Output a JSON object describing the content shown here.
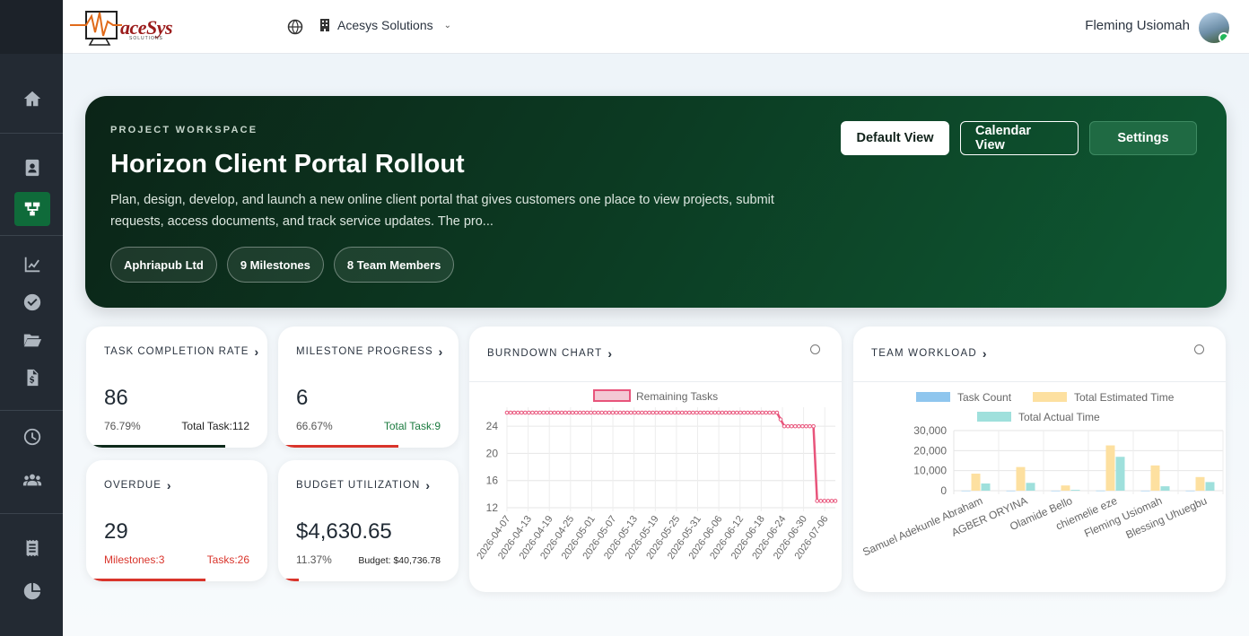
{
  "header": {
    "brand_text": "aceSys",
    "brand_sub": "SOLUTIONS",
    "org_name": "Acesys Solutions",
    "user_name": "Fleming Usiomah"
  },
  "sidebar": {
    "items": [
      {
        "icon": "home-icon"
      },
      {
        "icon": "contacts-icon"
      },
      {
        "icon": "project-tree-icon",
        "active": true
      },
      {
        "icon": "chart-line-icon"
      },
      {
        "icon": "check-circle-icon"
      },
      {
        "icon": "folder-open-icon"
      },
      {
        "icon": "invoice-icon"
      },
      {
        "icon": "clock-icon"
      },
      {
        "icon": "users-icon"
      },
      {
        "icon": "receipt-icon"
      },
      {
        "icon": "pie-chart-icon"
      }
    ]
  },
  "hero": {
    "kicker": "PROJECT WORKSPACE",
    "title": "Horizon Client Portal Rollout",
    "description": "Plan, design, develop, and launch a new online client portal that gives customers one place to view projects, submit requests, access documents, and track service updates. The pro...",
    "pills": [
      "Aphriapub Ltd",
      "9 Milestones",
      "8 Team Members"
    ],
    "buttons": {
      "default_view": "Default View",
      "calendar_view": "Calendar View",
      "settings": "Settings"
    }
  },
  "stats": {
    "task_completion": {
      "title": "TASK COMPLETION RATE",
      "value": "86",
      "left": "76.79%",
      "right": "Total Task:112",
      "progress": 0.7679,
      "bar_color": "#0e2a1b"
    },
    "milestone_progress": {
      "title": "MILESTONE PROGRESS",
      "value": "6",
      "left": "66.67%",
      "right": "Total Task:9",
      "progress": 0.6667,
      "bar_color": "#d9342b"
    },
    "overdue": {
      "title": "OVERDUE",
      "value": "29",
      "left": "Milestones:3",
      "right": "Tasks:26",
      "progress": 0.66,
      "bar_color": "#d9342b"
    },
    "budget": {
      "title": "BUDGET UTILIZATION",
      "value": "$4,630.65",
      "left": "11.37%",
      "right": "Budget: $40,736.78",
      "progress": 0.1137,
      "bar_color": "#d9342b"
    }
  },
  "colors": {
    "accent_green": "#0f6b3a",
    "danger": "#d9342b",
    "burndown_line": "#e8547b",
    "task_count": "#8fc6ee",
    "estimated": "#fde0a0",
    "actual": "#9fe0dc"
  },
  "chart_data": [
    {
      "type": "line",
      "title": "BURNDOWN CHART",
      "series": [
        {
          "name": "Remaining Tasks",
          "values": [
            26,
            26,
            26,
            26,
            26,
            26,
            26,
            26,
            26,
            26,
            26,
            26,
            26,
            26,
            26,
            26,
            26,
            26,
            26,
            26,
            26,
            26,
            26,
            26,
            26,
            26,
            26,
            26,
            26,
            26,
            26,
            26,
            26,
            26,
            26,
            26,
            26,
            26,
            26,
            26,
            26,
            26,
            26,
            26,
            26,
            26,
            26,
            26,
            26,
            26,
            26,
            26,
            26,
            26,
            26,
            26,
            26,
            26,
            26,
            26,
            26,
            26,
            26,
            26,
            26,
            26,
            26,
            26,
            26,
            26,
            26,
            26,
            26,
            26,
            26,
            25,
            24,
            24,
            24,
            24,
            24,
            24,
            24,
            24,
            24,
            13,
            13,
            13,
            13,
            13,
            13
          ]
        }
      ],
      "x_labels": [
        "2026-04-07",
        "2026-04-13",
        "2026-04-19",
        "2026-04-25",
        "2026-05-01",
        "2026-05-07",
        "2026-05-13",
        "2026-05-19",
        "2026-05-25",
        "2026-05-31",
        "2026-06-06",
        "2026-06-12",
        "2026-06-18",
        "2026-06-24",
        "2026-06-30",
        "2026-07-06"
      ],
      "x_start": "2026-04-07",
      "x_end": "2026-07-09",
      "y_ticks": [
        12,
        16,
        20,
        24
      ],
      "ylim": [
        12,
        26
      ],
      "grid": true,
      "legend": "top"
    },
    {
      "type": "bar",
      "title": "TEAM WORKLOAD",
      "categories": [
        "Samuel Adekunle Abraham",
        "AGBER ORYINA",
        "Olamide Bello",
        "chiemelie eze",
        "Fleming Usiomah",
        "Blessing Uhuegbu"
      ],
      "series": [
        {
          "name": "Task Count",
          "values": [
            14,
            10,
            8,
            40,
            10,
            12
          ]
        },
        {
          "name": "Total Estimated Time",
          "values": [
            8500,
            11800,
            2600,
            22600,
            12600,
            6800
          ]
        },
        {
          "name": "Total Actual Time",
          "values": [
            3600,
            3900,
            400,
            16900,
            2200,
            4300
          ]
        }
      ],
      "y_ticks": [
        "0",
        "10,000",
        "20,000",
        "30,000"
      ],
      "ylim": [
        0,
        30000
      ],
      "grid": true,
      "legend": "top"
    }
  ]
}
